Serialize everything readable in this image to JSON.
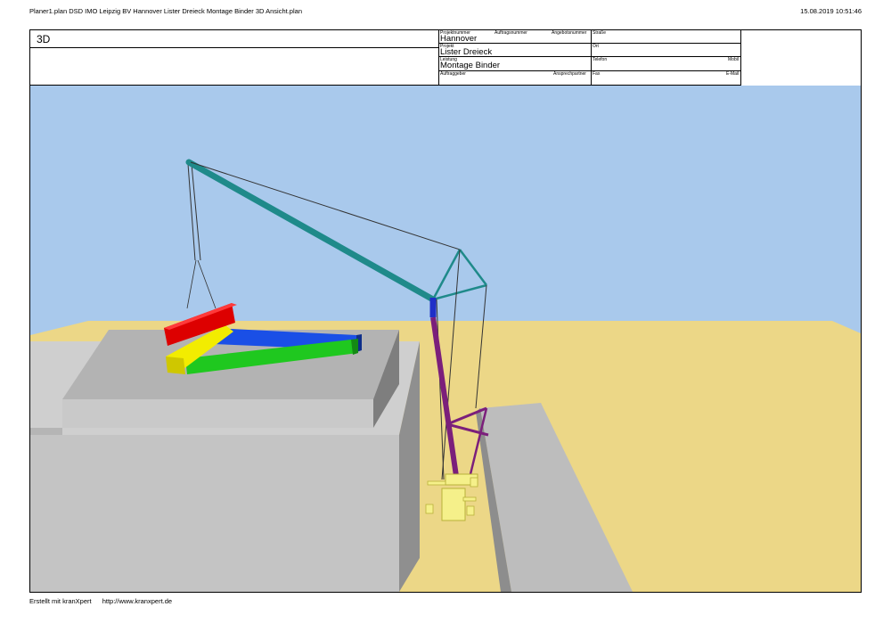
{
  "header": {
    "file_title": "Planer1.plan DSD IMO Leipzig BV Hannover Lister Dreieck Montage Binder 3D Ansicht.plan",
    "timestamp": "15.08.2019 10:51:46"
  },
  "titleblock": {
    "view_label": "3D",
    "projektnummer_label": "Projektnummer",
    "auftragsnummer_label": "Auftragsnummer",
    "angebotsnummer_label": "Angebotsnummer",
    "projektnummer_value": "Hannover",
    "projekt_label": "Projekt",
    "projekt_value": "Lister Dreieck",
    "leistung_label": "Leistung",
    "leistung_value": "Montage Binder",
    "auftraggeber_label": "Auftraggeber",
    "ansprechpartner_label": "Ansprechpartner",
    "strasse_label": "Straße",
    "ort_label": "Ort",
    "telefon_label": "Telefon",
    "mobil_label": "Mobil",
    "fax_label": "Fax",
    "email_label": "E-Mail"
  },
  "footer": {
    "created_with": "Erstellt mit kranXpert",
    "url": "http://www.kranxpert.de"
  },
  "scene_colors": {
    "sky": "#a9c9ec",
    "ground": "#ecd787",
    "building": "#c4c4c4",
    "boom": "#1f8a8a",
    "mast": "#7b1f7b",
    "crane_base": "#f5f08a",
    "beam_red": "#dd0000",
    "beam_yellow": "#f2ec00",
    "beam_blue": "#1a4fe6",
    "beam_green": "#1fc81f"
  }
}
